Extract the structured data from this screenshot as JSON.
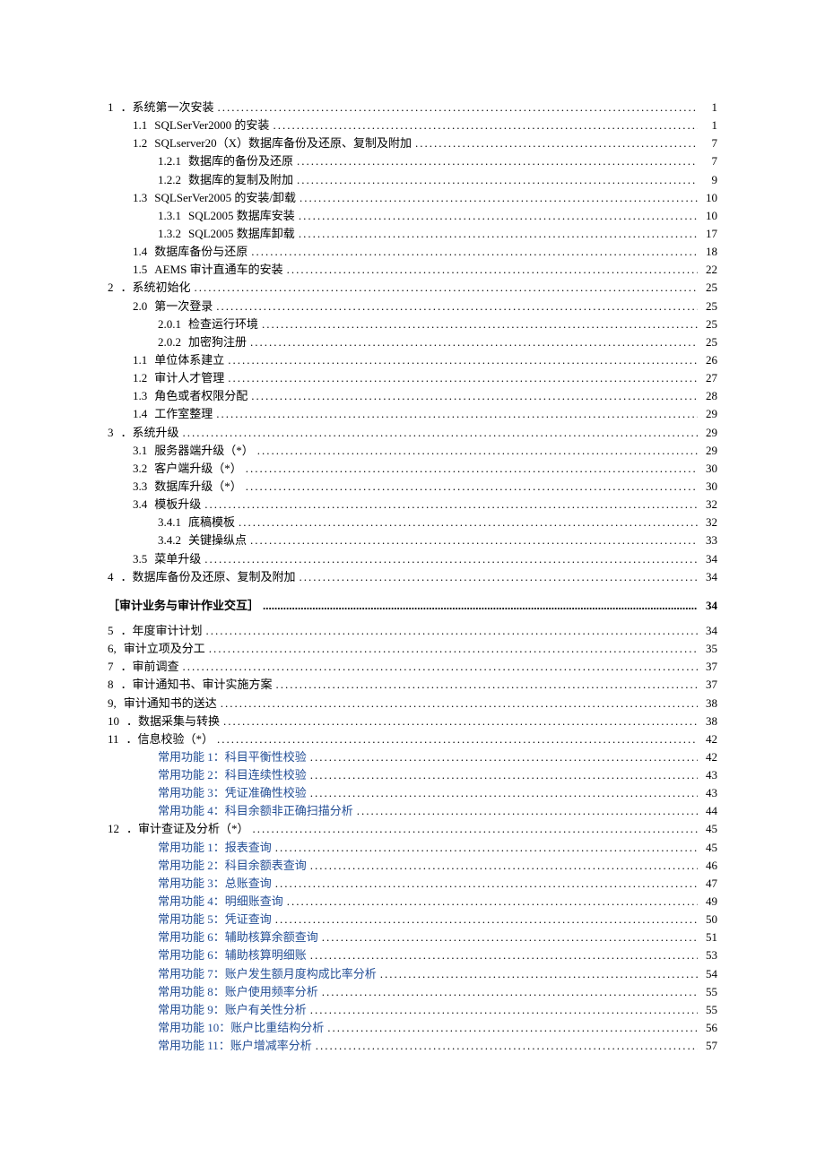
{
  "toc": [
    {
      "indent": 0,
      "num": "1",
      "label": "．系统第一次安装",
      "page": "1"
    },
    {
      "indent": 1,
      "num": "1.1",
      "label": "SQLSerVer2000 的安装",
      "page": "1"
    },
    {
      "indent": 1,
      "num": "1.2",
      "label": "SQLserver20（X）数据库备份及还原、复制及附加",
      "page": "7"
    },
    {
      "indent": 2,
      "num": "1.2.1",
      "label": "数据库的备份及还原",
      "page": "7"
    },
    {
      "indent": 2,
      "num": "1.2.2",
      "label": "数据库的复制及附加",
      "page": "9"
    },
    {
      "indent": 1,
      "num": "1.3",
      "label": "SQLSerVer2005 的安装/卸载",
      "page": "10"
    },
    {
      "indent": 2,
      "num": "1.3.1",
      "label": "SQL2005 数据库安装",
      "page": "10"
    },
    {
      "indent": 2,
      "num": "1.3.2",
      "label": "SQL2005 数据库卸载",
      "page": "17"
    },
    {
      "indent": 1,
      "num": "1.4",
      "label": "数据库备份与还原",
      "page": "18"
    },
    {
      "indent": 1,
      "num": "1.5",
      "label": "AEMS 审计直通车的安装",
      "page": "22"
    },
    {
      "indent": 0,
      "num": "2",
      "label": "．系统初始化",
      "page": "25"
    },
    {
      "indent": 1,
      "num": "2.0",
      "label": "第一次登录",
      "page": "25"
    },
    {
      "indent": 2,
      "num": "2.0.1",
      "label": "检查运行环境",
      "page": "25"
    },
    {
      "indent": 2,
      "num": "2.0.2",
      "label": "加密狗注册",
      "page": "25"
    },
    {
      "indent": 1,
      "num": "1.1",
      "label": "单位体系建立",
      "page": "26"
    },
    {
      "indent": 1,
      "num": "1.2",
      "label": "审计人才管理",
      "page": "27"
    },
    {
      "indent": 1,
      "num": "1.3",
      "label": "角色或者权限分配",
      "page": "28"
    },
    {
      "indent": 1,
      "num": "1.4",
      "label": "工作室整理",
      "page": "29"
    },
    {
      "indent": 0,
      "num": "3",
      "label": "．系统升级",
      "page": "29"
    },
    {
      "indent": 1,
      "num": "3.1",
      "label": "服务器端升级（*）",
      "page": "29"
    },
    {
      "indent": 1,
      "num": "3.2",
      "label": "客户端升级（*）",
      "page": "30"
    },
    {
      "indent": 1,
      "num": "3.3",
      "label": "数据库升级（*）",
      "page": "30"
    },
    {
      "indent": 1,
      "num": "3.4",
      "label": "模板升级",
      "page": "32"
    },
    {
      "indent": 2,
      "num": "3.4.1",
      "label": "底稿模板",
      "page": "32"
    },
    {
      "indent": 2,
      "num": "3.4.2",
      "label": "关键操纵点",
      "page": "33"
    },
    {
      "indent": 1,
      "num": "3.5",
      "label": "菜单升级",
      "page": "34"
    },
    {
      "indent": 0,
      "num": "4",
      "label": "．数据库备份及还原、复制及附加",
      "page": "34"
    }
  ],
  "section_heading": {
    "label": "［审计业务与审计作业交互］",
    "page": "34"
  },
  "toc2": [
    {
      "indent": 0,
      "num": "5",
      "label": "．年度审计计划",
      "page": "34"
    },
    {
      "indent": 0,
      "num": "6,",
      "label": "审计立项及分工",
      "page": "35"
    },
    {
      "indent": 0,
      "num": "7",
      "label": "．审前调查",
      "page": "37"
    },
    {
      "indent": 0,
      "num": "8",
      "label": "．审计通知书、审计实施方案",
      "page": "37"
    },
    {
      "indent": 0,
      "num": "9,",
      "label": "审计通知书的送达",
      "page": "38"
    },
    {
      "indent": 0,
      "num": "10",
      "label": "．数据采集与转换",
      "page": "38"
    },
    {
      "indent": 0,
      "num": "11",
      "label": "．信息校验（*）",
      "page": "42"
    },
    {
      "indent": 3,
      "fn": true,
      "num": "",
      "label": "常用功能 1：科目平衡性校验",
      "page": "42"
    },
    {
      "indent": 3,
      "fn": true,
      "num": "",
      "label": "常用功能 2：科目连续性校验",
      "page": "43"
    },
    {
      "indent": 3,
      "fn": true,
      "num": "",
      "label": "常用功能 3：凭证准确性校验",
      "page": "43"
    },
    {
      "indent": 3,
      "fn": true,
      "num": "",
      "label": "常用功能 4：科目余额非正确扫描分析",
      "page": "44"
    },
    {
      "indent": 0,
      "num": "12",
      "label": "．审计查证及分析（*）",
      "page": "45"
    },
    {
      "indent": 3,
      "fn": true,
      "num": "",
      "label": "常用功能 1：报表查询",
      "page": "45"
    },
    {
      "indent": 3,
      "fn": true,
      "num": "",
      "label": "常用功能 2：科目余额表查询",
      "page": "46"
    },
    {
      "indent": 3,
      "fn": true,
      "num": "",
      "label": "常用功能 3：总账查询",
      "page": "47"
    },
    {
      "indent": 3,
      "fn": true,
      "num": "",
      "label": "常用功能 4：明细账查询",
      "page": "49"
    },
    {
      "indent": 3,
      "fn": true,
      "num": "",
      "label": "常用功能 5：凭证查询",
      "page": "50"
    },
    {
      "indent": 3,
      "fn": true,
      "num": "",
      "label": "常用功能 6：辅助核算余额查询",
      "page": "51"
    },
    {
      "indent": 3,
      "fn": true,
      "num": "",
      "label": "常用功能 6：辅助核算明细账",
      "page": "53"
    },
    {
      "indent": 3,
      "fn": true,
      "num": "",
      "label": "常用功能 7：账户发生额月度构成比率分析",
      "page": "54"
    },
    {
      "indent": 3,
      "fn": true,
      "num": "",
      "label": "常用功能 8：账户使用频率分析",
      "page": "55"
    },
    {
      "indent": 3,
      "fn": true,
      "num": "",
      "label": "常用功能 9：账户有关性分析",
      "page": "55"
    },
    {
      "indent": 3,
      "fn": true,
      "num": "",
      "label": "常用功能 10：账户比重结构分析",
      "page": "56"
    },
    {
      "indent": 3,
      "fn": true,
      "num": "",
      "label": "常用功能 11：账户增减率分析",
      "page": "57"
    }
  ]
}
